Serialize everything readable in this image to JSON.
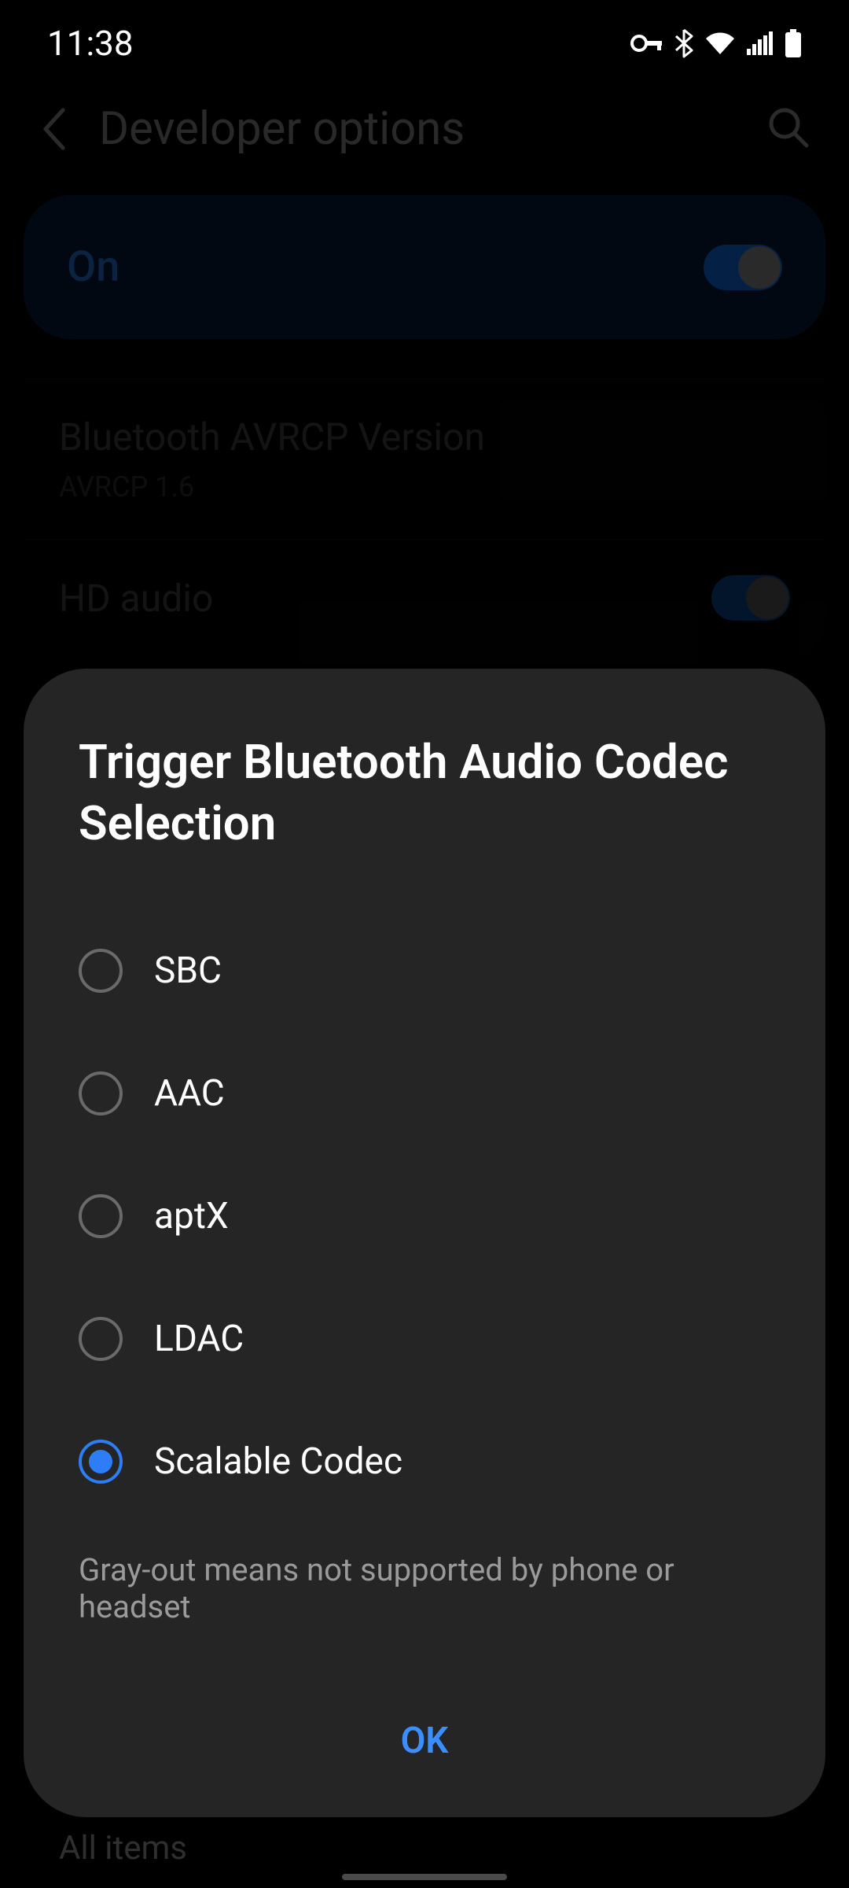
{
  "status": {
    "time": "11:38"
  },
  "header": {
    "title": "Developer options"
  },
  "master_toggle": {
    "label": "On",
    "on": true
  },
  "settings": {
    "avrcp": {
      "title": "Bluetooth AVRCP Version",
      "subtitle": "AVRCP 1.6"
    },
    "hd_audio": {
      "title": "HD audio",
      "on": true
    }
  },
  "dialog": {
    "title": "Trigger Bluetooth Audio Codec Selection",
    "options": [
      {
        "label": "SBC",
        "selected": false
      },
      {
        "label": "AAC",
        "selected": false
      },
      {
        "label": "aptX",
        "selected": false
      },
      {
        "label": "LDAC",
        "selected": false
      },
      {
        "label": "Scalable Codec",
        "selected": true
      }
    ],
    "note": "Gray-out means not supported by phone or headset",
    "ok_label": "OK"
  },
  "bottom_peek": "All items"
}
